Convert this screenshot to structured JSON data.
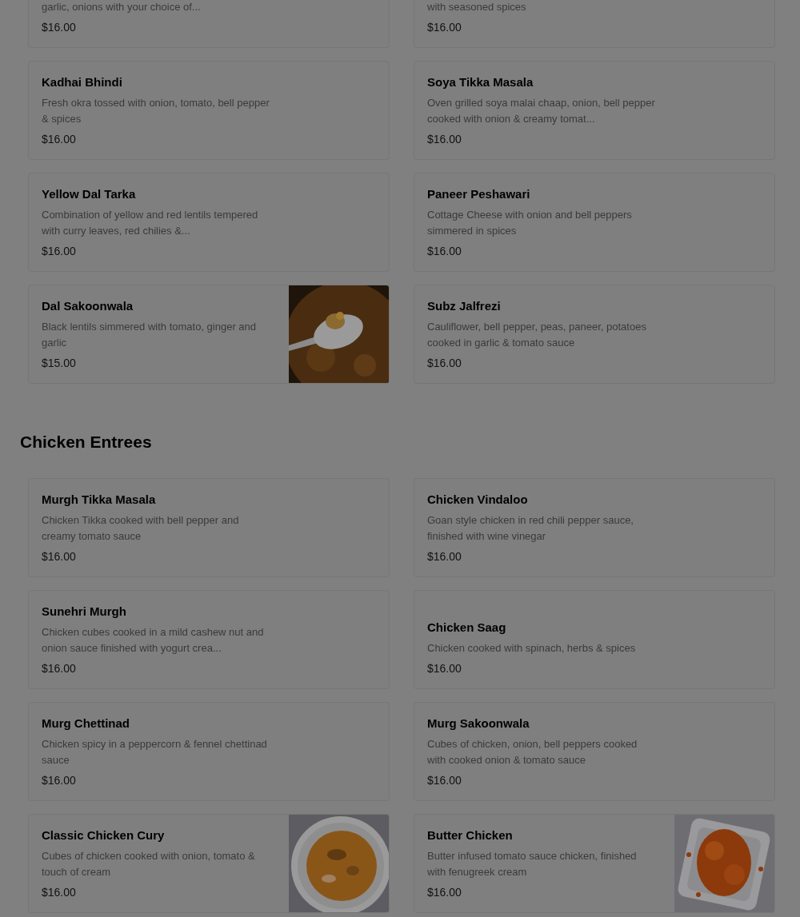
{
  "sections": [
    {
      "items": [
        {
          "kind": "cut",
          "description": "garlic, onions with your choice of...",
          "price": "$16.00"
        },
        {
          "kind": "cut",
          "description": "with seasoned spices",
          "price": "$16.00"
        },
        {
          "kind": "full",
          "name": "Kadhai Bhindi",
          "description": "Fresh okra tossed with onion, tomato, bell pepper & spices",
          "price": "$16.00"
        },
        {
          "kind": "full",
          "name": "Soya Tikka Masala",
          "description": "Oven grilled soya malai chaap, onion, bell pepper cooked with onion & creamy tomat...",
          "price": "$16.00"
        },
        {
          "kind": "full",
          "name": "Yellow Dal Tarka",
          "description": "Combination of yellow and red lentils tempered with curry leaves, red chilies &...",
          "price": "$16.00"
        },
        {
          "kind": "full",
          "name": "Paneer Peshawari",
          "description": "Cottage Cheese with onion and bell peppers simmered in spices",
          "price": "$16.00"
        },
        {
          "kind": "full",
          "name": "Dal Sakoonwala",
          "description": "Black lentils simmered with tomato, ginger and garlic",
          "price": "$15.00"
        },
        {
          "kind": "full",
          "name": "Subz Jalfrezi",
          "description": "Cauliflower, bell pepper, peas, paneer, potatoes cooked in garlic & tomato sauce",
          "price": "$16.00"
        }
      ]
    },
    {
      "title": "Chicken Entrees",
      "items": [
        {
          "kind": "full",
          "name": "Murgh Tikka Masala",
          "description": "Chicken Tikka cooked with bell pepper and creamy tomato sauce",
          "price": "$16.00"
        },
        {
          "kind": "full",
          "name": "Chicken Vindaloo",
          "description": "Goan style chicken in red chili pepper sauce, finished with wine vinegar",
          "price": "$16.00"
        },
        {
          "kind": "full",
          "name": "Sunehri Murgh",
          "description": "Chicken cubes cooked in a mild cashew nut and onion sauce finished with yogurt crea...",
          "price": "$16.00"
        },
        {
          "kind": "full",
          "name": "Chicken Saag",
          "description": "Chicken cooked with spinach, herbs & spices",
          "price": "$16.00"
        },
        {
          "kind": "full",
          "name": "Murg Chettinad",
          "description": "Chicken spicy in a peppercorn & fennel chettinad sauce",
          "price": "$16.00"
        },
        {
          "kind": "full",
          "name": "Murg Sakoonwala",
          "description": "Cubes of chicken, onion, bell peppers cooked with cooked onion & tomato sauce",
          "price": "$16.00"
        },
        {
          "kind": "full",
          "name": "Classic Chicken Cury",
          "description": "Cubes of chicken cooked with onion, tomato & touch of cream",
          "price": "$16.00"
        },
        {
          "kind": "full",
          "name": "Butter Chicken",
          "description": "Butter infused tomato sauce chicken, finished with fenugreek cream",
          "price": "$16.00"
        }
      ]
    }
  ]
}
